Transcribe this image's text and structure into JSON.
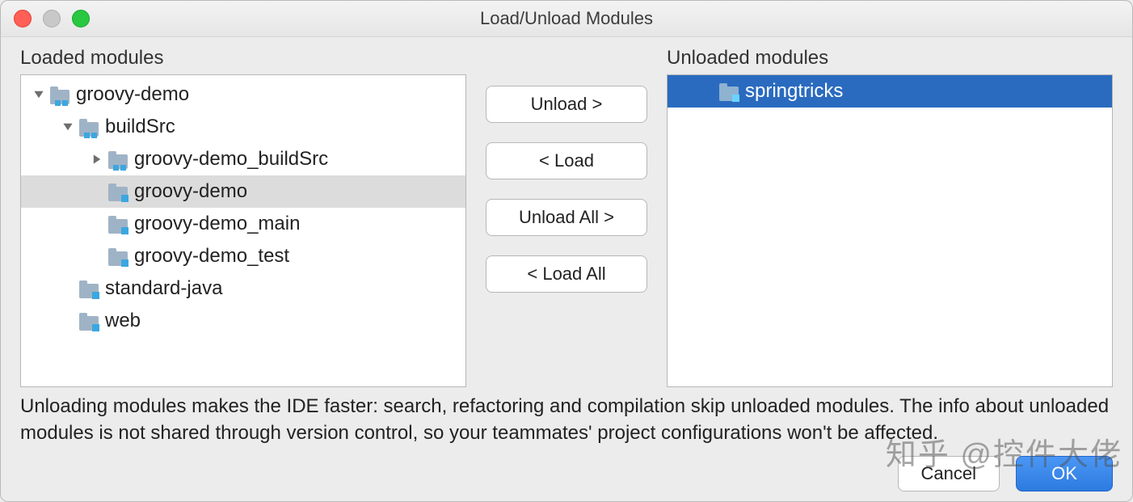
{
  "window": {
    "title": "Load/Unload Modules"
  },
  "labels": {
    "loaded": "Loaded modules",
    "unloaded": "Unloaded modules"
  },
  "loaded_tree": [
    {
      "name": "groovy-demo",
      "indent": 0,
      "disclosure": "open",
      "icon": "module-group",
      "selected": ""
    },
    {
      "name": "buildSrc",
      "indent": 1,
      "disclosure": "open",
      "icon": "module-group",
      "selected": ""
    },
    {
      "name": "groovy-demo_buildSrc",
      "indent": 2,
      "disclosure": "closed",
      "icon": "module-group",
      "selected": ""
    },
    {
      "name": "groovy-demo",
      "indent": 2,
      "disclosure": "none",
      "icon": "module",
      "selected": "grey"
    },
    {
      "name": "groovy-demo_main",
      "indent": 2,
      "disclosure": "none",
      "icon": "module",
      "selected": ""
    },
    {
      "name": "groovy-demo_test",
      "indent": 2,
      "disclosure": "none",
      "icon": "module",
      "selected": ""
    },
    {
      "name": "standard-java",
      "indent": 1,
      "disclosure": "none",
      "icon": "module",
      "selected": ""
    },
    {
      "name": "web",
      "indent": 1,
      "disclosure": "none",
      "icon": "module",
      "selected": ""
    }
  ],
  "unloaded_tree": [
    {
      "name": "springtricks",
      "indent": 0,
      "disclosure": "none",
      "icon": "module",
      "selected": "blue"
    }
  ],
  "buttons": {
    "unload": "Unload >",
    "load": "< Load",
    "unload_all": "Unload All >",
    "load_all": "< Load All"
  },
  "description": "Unloading modules makes the IDE faster: search, refactoring and compilation skip unloaded modules. The info about unloaded modules is not shared through version control, so your teammates' project configurations won't be affected.",
  "footer": {
    "cancel": "Cancel",
    "ok": "OK"
  },
  "watermark": "知乎 @控件大佬"
}
